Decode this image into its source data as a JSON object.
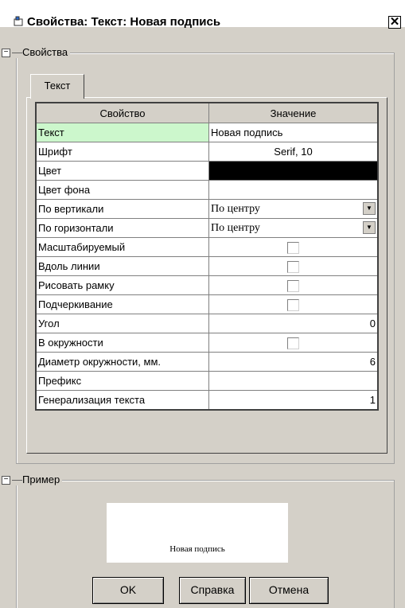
{
  "window": {
    "title": "Свойства: Текст: Новая подпись",
    "close_glyph": "✕"
  },
  "properties_section": {
    "toggle": "−",
    "label": "Свойства"
  },
  "tab": {
    "label": "Текст"
  },
  "grid": {
    "headers": [
      "Свойство",
      "Значение"
    ],
    "rows": [
      {
        "name": "Текст",
        "value": "Новая подпись"
      },
      {
        "name": "Шрифт",
        "value": "Serif, 10"
      },
      {
        "name": "Цвет",
        "value": "",
        "color": "#000000"
      },
      {
        "name": "Цвет фона",
        "value": ""
      },
      {
        "name": "По вертикали",
        "value": "По центру"
      },
      {
        "name": "По горизонтали",
        "value": "По центру"
      },
      {
        "name": "Масштабируемый",
        "checked": false
      },
      {
        "name": "Вдоль линии",
        "checked": false
      },
      {
        "name": "Рисовать рамку",
        "checked": false
      },
      {
        "name": "Подчеркивание",
        "checked": false
      },
      {
        "name": "Угол",
        "value": "0"
      },
      {
        "name": "В окружности",
        "checked": false
      },
      {
        "name": "Диаметр окружности, мм.",
        "value": "6"
      },
      {
        "name": "Префикс",
        "value": ""
      },
      {
        "name": "Генерализация текста",
        "value": "1"
      }
    ]
  },
  "example_section": {
    "toggle": "−",
    "label": "Пример",
    "preview_text": "Новая подпись"
  },
  "buttons": {
    "ok": "OK",
    "help": "Справка",
    "cancel": "Отмена"
  },
  "colors": {
    "highlight": "#ccf7cc",
    "window_bg": "#d4d0c8"
  }
}
